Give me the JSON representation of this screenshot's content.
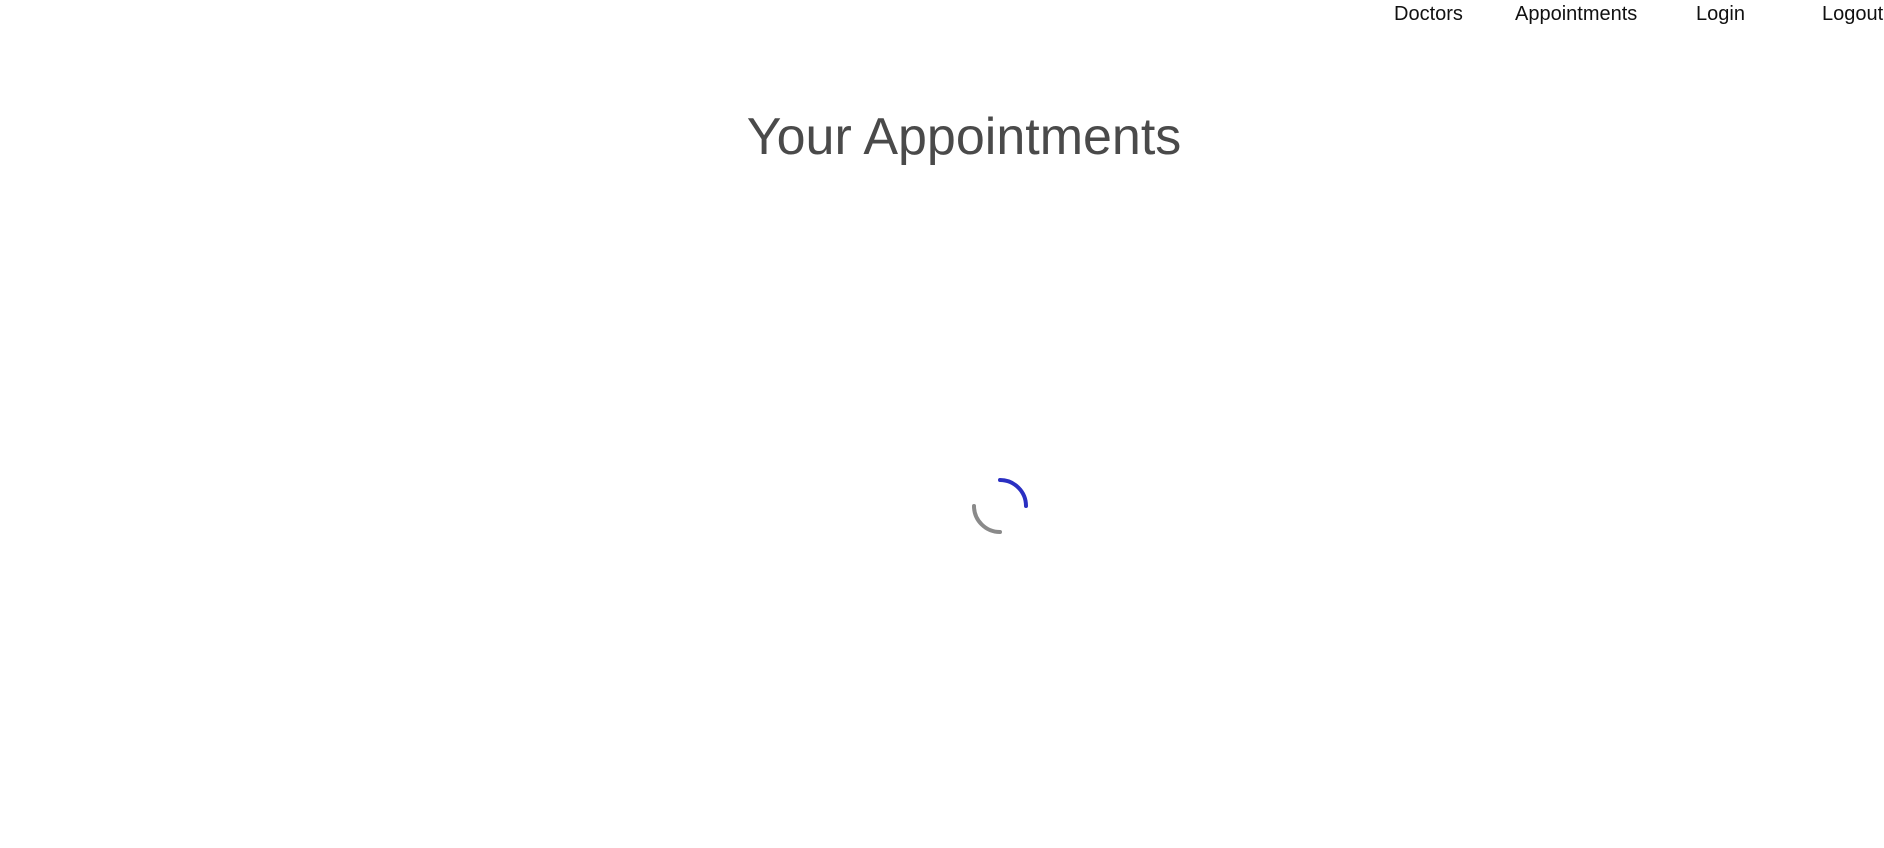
{
  "nav": {
    "items": [
      {
        "label": "Doctors"
      },
      {
        "label": "Appointments"
      },
      {
        "label": "Login"
      },
      {
        "label": "Logout"
      }
    ]
  },
  "main": {
    "title": "Your Appointments"
  },
  "loading": {
    "icon": "spinner-icon",
    "colors": {
      "accent": "#2a2fc2",
      "track": "#8a8a8a"
    }
  }
}
